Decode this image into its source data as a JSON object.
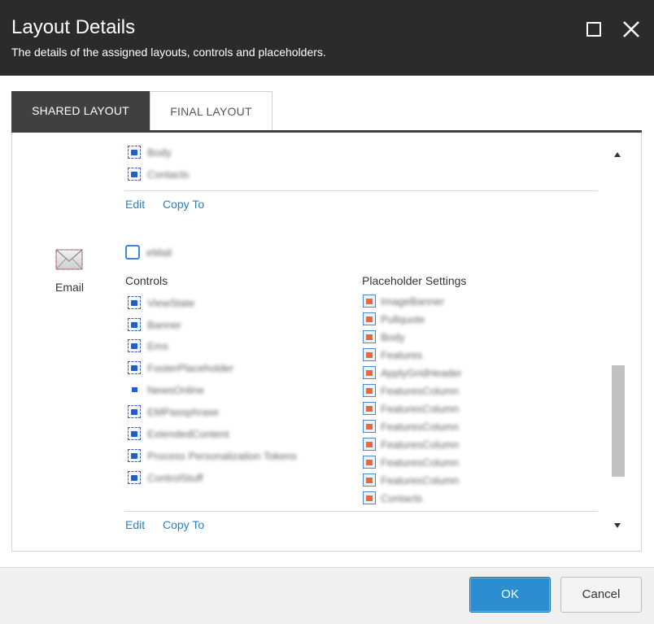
{
  "header": {
    "title": "Layout Details",
    "subtitle": "The details of the assigned layouts, controls and placeholders."
  },
  "tabs": [
    {
      "label": "SHARED LAYOUT",
      "active": true
    },
    {
      "label": "FINAL LAYOUT",
      "active": false
    }
  ],
  "panel": {
    "top_controls": [
      "Body",
      "Contacts"
    ],
    "top_links": {
      "edit": "Edit",
      "copy_to": "Copy To"
    },
    "device": {
      "label": "Email",
      "icon": "envelope-icon"
    },
    "layout_name": "eMail",
    "controls_heading": "Controls",
    "placeholder_heading": "Placeholder Settings",
    "controls": [
      {
        "name": "ViewState",
        "icon": "rendering"
      },
      {
        "name": "Banner",
        "icon": "rendering"
      },
      {
        "name": "Ems",
        "icon": "rendering"
      },
      {
        "name": "FooterPlaceholder",
        "icon": "rendering"
      },
      {
        "name": "NewsOnline",
        "icon": "small"
      },
      {
        "name": "EMPassphrase",
        "icon": "rendering"
      },
      {
        "name": "ExtendedContent",
        "icon": "rendering"
      },
      {
        "name": "Process Personalization Tokens",
        "icon": "rendering"
      },
      {
        "name": "ControlStuff",
        "icon": "rendering"
      }
    ],
    "placeholders": [
      "ImageBanner",
      "Pullquote",
      "Body",
      "Features",
      "ApplyGridHeader",
      "FeaturesColumn",
      "FeaturesColumn",
      "FeaturesColumn",
      "FeaturesColumn",
      "FeaturesColumn",
      "FeaturesColumn",
      "Contacts"
    ],
    "bottom_links": {
      "edit": "Edit",
      "copy_to": "Copy To"
    }
  },
  "footer": {
    "ok_label": "OK",
    "cancel_label": "Cancel"
  },
  "colors": {
    "header_bg": "#2b2b2b",
    "active_tab_bg": "#404040",
    "link": "#2b7fc2",
    "primary_button": "#2a8ed0"
  }
}
